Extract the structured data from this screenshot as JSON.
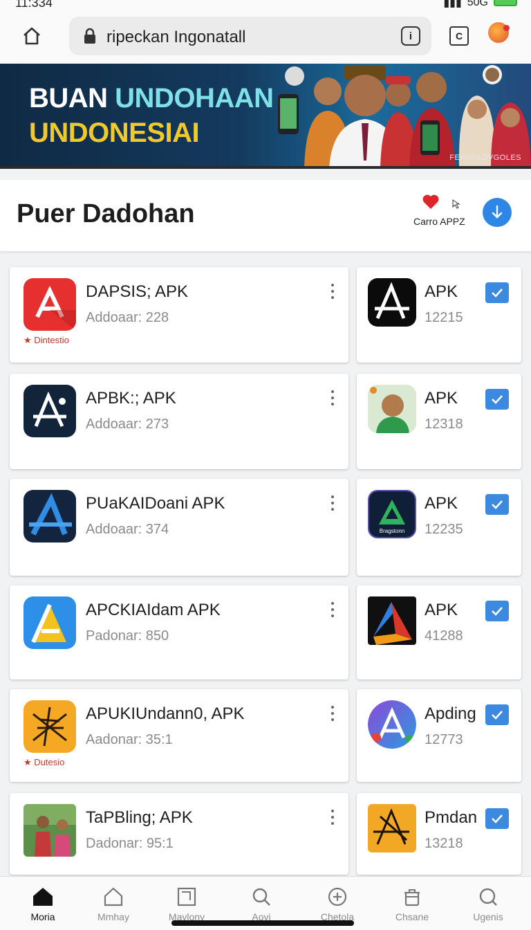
{
  "status_bar": {
    "time": "11:334",
    "right_text": "50G"
  },
  "browser": {
    "url": "ripeckan Ingonatall",
    "info_icon": "info-icon",
    "tabs_icon": "tabs-icon"
  },
  "banner": {
    "line1_white": "BUAN ",
    "line1_cyan": "UNDOHAAN",
    "line2": "UNDONESIAI",
    "credit": "FERSOLDVGOLES"
  },
  "header": {
    "title": "Puer Dadohan",
    "catalog_label": "Carro APPZ"
  },
  "apps_left": [
    {
      "name": "DAPSIS; APK",
      "subtitle": "Addoaar: 228",
      "featured": "Dintestio"
    },
    {
      "name": "APBK:; APK",
      "subtitle": "Addoaar: 273",
      "featured": ""
    },
    {
      "name": "PUaKAIDoani APK",
      "subtitle": "Addoaar: 374",
      "featured": ""
    },
    {
      "name": "APCKIAIdam APK",
      "subtitle": "Padonar: 850",
      "featured": ""
    },
    {
      "name": "APUKIUndann0, APK",
      "subtitle": "Aadonar: 35:1",
      "featured": "Dutesio"
    },
    {
      "name": "TaPBling; APK",
      "subtitle": "Dadonar: 95:1",
      "featured": ""
    }
  ],
  "apps_right": [
    {
      "name": "APK",
      "subtitle": "12215",
      "checked": true
    },
    {
      "name": "APK",
      "subtitle": "12318",
      "checked": true
    },
    {
      "name": "APK",
      "subtitle": "12235",
      "checked": true,
      "icon_caption": "Bragstonn"
    },
    {
      "name": "APK",
      "subtitle": "41288",
      "checked": true
    },
    {
      "name": "Apding",
      "subtitle": "12773",
      "checked": true
    },
    {
      "name": "Pmdan",
      "subtitle": "13218",
      "checked": true
    }
  ],
  "bottom_nav": [
    {
      "label": "Moria",
      "icon": "home-filled-icon",
      "active": true
    },
    {
      "label": "Mmhay",
      "icon": "home-outline-icon",
      "active": false
    },
    {
      "label": "Mavlony",
      "icon": "square-icon",
      "active": false
    },
    {
      "label": "Aovi",
      "icon": "search-icon",
      "active": false
    },
    {
      "label": "Chetola",
      "icon": "plus-circle-icon",
      "active": false
    },
    {
      "label": "Chsane",
      "icon": "trash-icon",
      "active": false
    },
    {
      "label": "Ugenis",
      "icon": "search-icon",
      "active": false
    }
  ],
  "colors": {
    "accent": "#2e86e6",
    "banner_yellow": "#f0c92a",
    "banner_cyan": "#7fe0e8",
    "tag_red": "#c0392b"
  }
}
